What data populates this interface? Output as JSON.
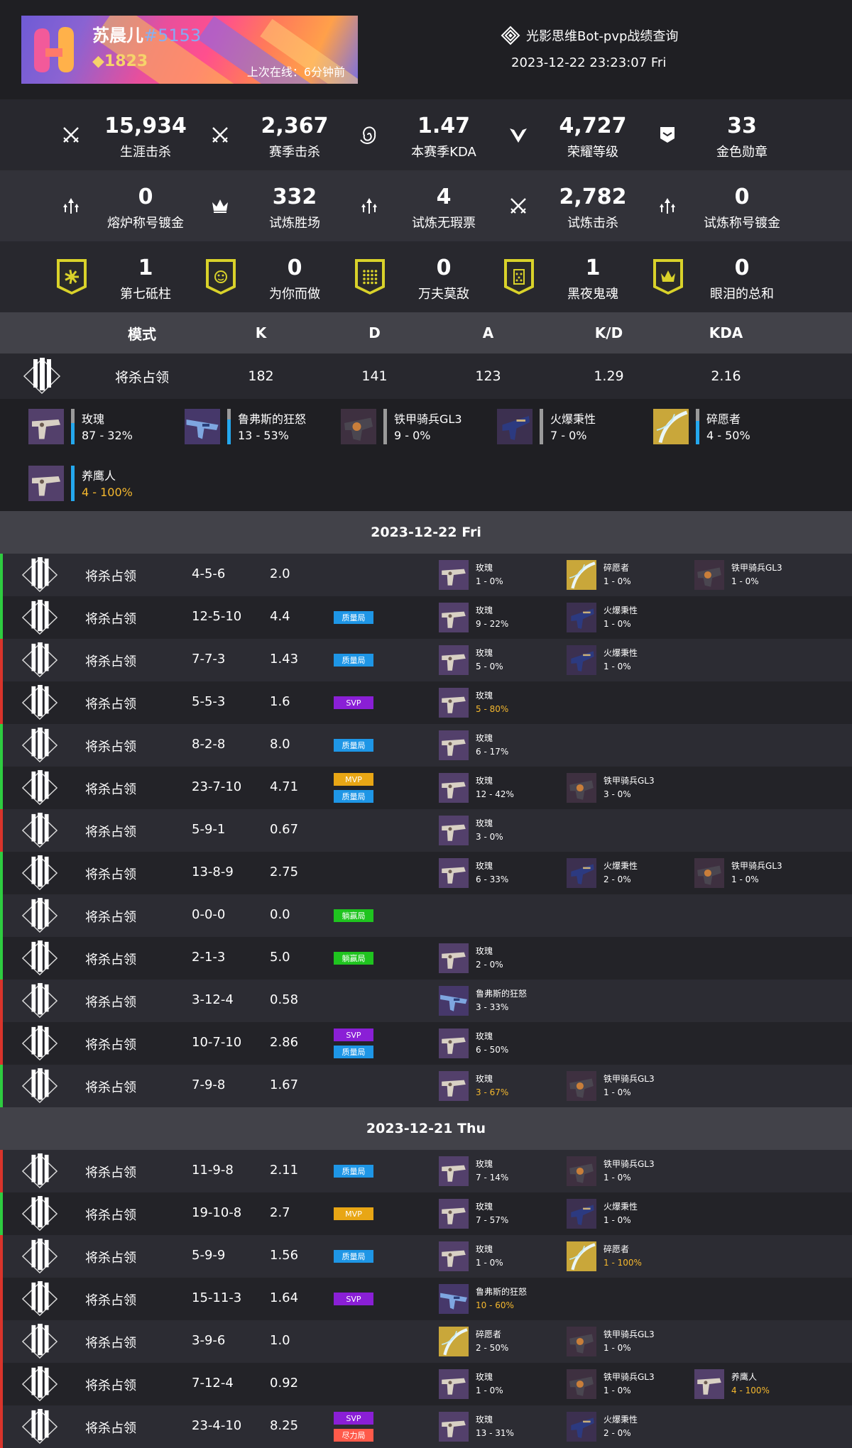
{
  "header": {
    "player_name": "苏晨儿",
    "player_tag": "#5153",
    "power_symbol": "◆",
    "power": "1823",
    "last_online": "上次在线：6分钟前",
    "app_title": "光影思维Bot-pvp战绩查询",
    "timestamp": "2023-12-22 23:23:07 Fri"
  },
  "stats_row1": [
    {
      "icon": "crossed-swords-icon",
      "value": "15,934",
      "label": "生涯击杀"
    },
    {
      "icon": "crossed-swords-icon",
      "value": "2,367",
      "label": "赛季击杀"
    },
    {
      "icon": "spiral-icon",
      "value": "1.47",
      "label": "本赛季KDA"
    },
    {
      "icon": "wings-icon",
      "value": "4,727",
      "label": "荣耀等级"
    },
    {
      "icon": "medal-icon",
      "value": "33",
      "label": "金色勋章"
    }
  ],
  "stats_row2": [
    {
      "icon": "triple-arrow-icon",
      "value": "0",
      "label": "熔炉称号镀金"
    },
    {
      "icon": "crown-icon",
      "value": "332",
      "label": "试炼胜场"
    },
    {
      "icon": "triple-arrow-icon",
      "value": "4",
      "label": "试炼无瑕票"
    },
    {
      "icon": "crossed-swords-icon",
      "value": "2,782",
      "label": "试炼击杀"
    },
    {
      "icon": "triple-arrow-icon",
      "value": "0",
      "label": "试炼称号镀金"
    }
  ],
  "stats_row3": [
    {
      "icon": "seal-seventh-column-icon",
      "value": "1",
      "label": "第七砥柱"
    },
    {
      "icon": "seal-for-you-icon",
      "value": "0",
      "label": "为你而做"
    },
    {
      "icon": "seal-grid-icon",
      "value": "0",
      "label": "万夫莫敌"
    },
    {
      "icon": "seal-dark-icon",
      "value": "1",
      "label": "黑夜鬼魂"
    },
    {
      "icon": "seal-crown-icon",
      "value": "0",
      "label": "眼泪的总和"
    }
  ],
  "mode_table": {
    "headers": [
      "模式",
      "K",
      "D",
      "A",
      "K/D",
      "KDA"
    ],
    "row": [
      "将杀占领",
      "182",
      "141",
      "123",
      "1.29",
      "2.16"
    ]
  },
  "weapons_summary": [
    {
      "name": "玫瑰",
      "stat": "87 - 32%",
      "pct": 0.32,
      "thumb": "hand-cannon-purple",
      "gold": false
    },
    {
      "name": "鲁弗斯的狂怒",
      "stat": "13 - 53%",
      "pct": 0.53,
      "thumb": "auto-rifle-blue",
      "gold": false
    },
    {
      "name": "铁甲骑兵GL3",
      "stat": "9 - 0%",
      "pct": 0.0,
      "thumb": "grenade-launcher",
      "gold": false
    },
    {
      "name": "火爆秉性",
      "stat": "7 - 0%",
      "pct": 0.0,
      "thumb": "sidearm-dark",
      "gold": false
    },
    {
      "name": "碎愿者",
      "stat": "4 - 50%",
      "pct": 0.5,
      "thumb": "bow-gold",
      "gold": false
    },
    {
      "name": "养鹰人",
      "stat": "4 - 100%",
      "pct": 1.0,
      "thumb": "hand-cannon-purple",
      "gold": true
    }
  ],
  "days": [
    {
      "date": "2023-12-22 Fri",
      "matches": [
        {
          "result": "win",
          "mode": "将杀占领",
          "kda": "4-5-6",
          "ratio": "2.0",
          "tags": [],
          "weapons": [
            [
              "玫瑰",
              "1 - 0%",
              "hand-cannon-purple",
              false
            ],
            [
              "碎愿者",
              "1 - 0%",
              "bow-gold",
              false
            ],
            [
              "铁甲骑兵GL3",
              "1 - 0%",
              "grenade-launcher",
              false
            ]
          ]
        },
        {
          "result": "win",
          "mode": "将杀占领",
          "kda": "12-5-10",
          "ratio": "4.4",
          "tags": [
            "质量局"
          ],
          "weapons": [
            [
              "玫瑰",
              "9 - 22%",
              "hand-cannon-purple",
              false
            ],
            [
              "火爆秉性",
              "1 - 0%",
              "sidearm-dark",
              false
            ]
          ]
        },
        {
          "result": "loss",
          "mode": "将杀占领",
          "kda": "7-7-3",
          "ratio": "1.43",
          "tags": [
            "质量局"
          ],
          "weapons": [
            [
              "玫瑰",
              "5 - 0%",
              "hand-cannon-purple",
              false
            ],
            [
              "火爆秉性",
              "1 - 0%",
              "sidearm-dark",
              false
            ]
          ]
        },
        {
          "result": "loss",
          "mode": "将杀占领",
          "kda": "5-5-3",
          "ratio": "1.6",
          "tags": [
            "SVP"
          ],
          "weapons": [
            [
              "玫瑰",
              "5 - 80%",
              "hand-cannon-purple",
              true
            ]
          ]
        },
        {
          "result": "win",
          "mode": "将杀占领",
          "kda": "8-2-8",
          "ratio": "8.0",
          "tags": [
            "质量局"
          ],
          "weapons": [
            [
              "玫瑰",
              "6 - 17%",
              "hand-cannon-purple",
              false
            ]
          ]
        },
        {
          "result": "win",
          "mode": "将杀占领",
          "kda": "23-7-10",
          "ratio": "4.71",
          "tags": [
            "MVP",
            "质量局"
          ],
          "weapons": [
            [
              "玫瑰",
              "12 - 42%",
              "hand-cannon-purple",
              false
            ],
            [
              "铁甲骑兵GL3",
              "3 - 0%",
              "grenade-launcher",
              false
            ]
          ]
        },
        {
          "result": "loss",
          "mode": "将杀占领",
          "kda": "5-9-1",
          "ratio": "0.67",
          "tags": [],
          "weapons": [
            [
              "玫瑰",
              "3 - 0%",
              "hand-cannon-purple",
              false
            ]
          ]
        },
        {
          "result": "win",
          "mode": "将杀占领",
          "kda": "13-8-9",
          "ratio": "2.75",
          "tags": [],
          "weapons": [
            [
              "玫瑰",
              "6 - 33%",
              "hand-cannon-purple",
              false
            ],
            [
              "火爆秉性",
              "2 - 0%",
              "sidearm-dark",
              false
            ],
            [
              "铁甲骑兵GL3",
              "1 - 0%",
              "grenade-launcher",
              false
            ]
          ]
        },
        {
          "result": "win",
          "mode": "将杀占领",
          "kda": "0-0-0",
          "ratio": "0.0",
          "tags": [
            "躺赢局"
          ],
          "weapons": []
        },
        {
          "result": "win",
          "mode": "将杀占领",
          "kda": "2-1-3",
          "ratio": "5.0",
          "tags": [
            "躺赢局"
          ],
          "weapons": [
            [
              "玫瑰",
              "2 - 0%",
              "hand-cannon-purple",
              false
            ]
          ]
        },
        {
          "result": "loss",
          "mode": "将杀占领",
          "kda": "3-12-4",
          "ratio": "0.58",
          "tags": [],
          "weapons": [
            [
              "鲁弗斯的狂怒",
              "3 - 33%",
              "auto-rifle-blue",
              false
            ]
          ]
        },
        {
          "result": "loss",
          "mode": "将杀占领",
          "kda": "10-7-10",
          "ratio": "2.86",
          "tags": [
            "SVP",
            "质量局"
          ],
          "weapons": [
            [
              "玫瑰",
              "6 - 50%",
              "hand-cannon-purple",
              false
            ]
          ]
        },
        {
          "result": "win",
          "mode": "将杀占领",
          "kda": "7-9-8",
          "ratio": "1.67",
          "tags": [],
          "weapons": [
            [
              "玫瑰",
              "3 - 67%",
              "hand-cannon-purple",
              true
            ],
            [
              "铁甲骑兵GL3",
              "1 - 0%",
              "grenade-launcher",
              false
            ]
          ]
        }
      ]
    },
    {
      "date": "2023-12-21 Thu",
      "matches": [
        {
          "result": "loss",
          "mode": "将杀占领",
          "kda": "11-9-8",
          "ratio": "2.11",
          "tags": [
            "质量局"
          ],
          "weapons": [
            [
              "玫瑰",
              "7 - 14%",
              "hand-cannon-purple",
              false
            ],
            [
              "铁甲骑兵GL3",
              "1 - 0%",
              "grenade-launcher",
              false
            ]
          ]
        },
        {
          "result": "win",
          "mode": "将杀占领",
          "kda": "19-10-8",
          "ratio": "2.7",
          "tags": [
            "MVP"
          ],
          "weapons": [
            [
              "玫瑰",
              "7 - 57%",
              "hand-cannon-purple",
              false
            ],
            [
              "火爆秉性",
              "1 - 0%",
              "sidearm-dark",
              false
            ]
          ]
        },
        {
          "result": "loss",
          "mode": "将杀占领",
          "kda": "5-9-9",
          "ratio": "1.56",
          "tags": [
            "质量局"
          ],
          "weapons": [
            [
              "玫瑰",
              "1 - 0%",
              "hand-cannon-purple",
              false
            ],
            [
              "碎愿者",
              "1 - 100%",
              "bow-gold",
              true
            ]
          ]
        },
        {
          "result": "loss",
          "mode": "将杀占领",
          "kda": "15-11-3",
          "ratio": "1.64",
          "tags": [
            "SVP"
          ],
          "weapons": [
            [
              "鲁弗斯的狂怒",
              "10 - 60%",
              "auto-rifle-blue",
              true
            ]
          ]
        },
        {
          "result": "loss",
          "mode": "将杀占领",
          "kda": "3-9-6",
          "ratio": "1.0",
          "tags": [],
          "weapons": [
            [
              "碎愿者",
              "2 - 50%",
              "bow-gold",
              false
            ],
            [
              "铁甲骑兵GL3",
              "1 - 0%",
              "grenade-launcher",
              false
            ]
          ]
        },
        {
          "result": "loss",
          "mode": "将杀占领",
          "kda": "7-12-4",
          "ratio": "0.92",
          "tags": [],
          "weapons": [
            [
              "玫瑰",
              "1 - 0%",
              "hand-cannon-purple",
              false
            ],
            [
              "铁甲骑兵GL3",
              "1 - 0%",
              "grenade-launcher",
              false
            ],
            [
              "养鹰人",
              "4 - 100%",
              "hand-cannon-purple",
              true
            ]
          ]
        },
        {
          "result": "loss",
          "mode": "将杀占领",
          "kda": "23-4-10",
          "ratio": "8.25",
          "tags": [
            "SVP",
            "尽力局"
          ],
          "weapons": [
            [
              "玫瑰",
              "13 - 31%",
              "hand-cannon-purple",
              false
            ],
            [
              "火爆秉性",
              "2 - 0%",
              "sidearm-dark",
              false
            ]
          ]
        }
      ]
    }
  ],
  "colors": {
    "win": "#2ecc40",
    "loss": "#d9342b",
    "tag_质量局": "#1e96e6",
    "tag_SVP": "#8a1fd6",
    "tag_MVP": "#e8a615",
    "tag_躺赢局": "#1fc41f",
    "tag_尽力局": "#ff5a4a",
    "gold_text": "#f5b82e",
    "accent_blue": "#24a8ee"
  }
}
